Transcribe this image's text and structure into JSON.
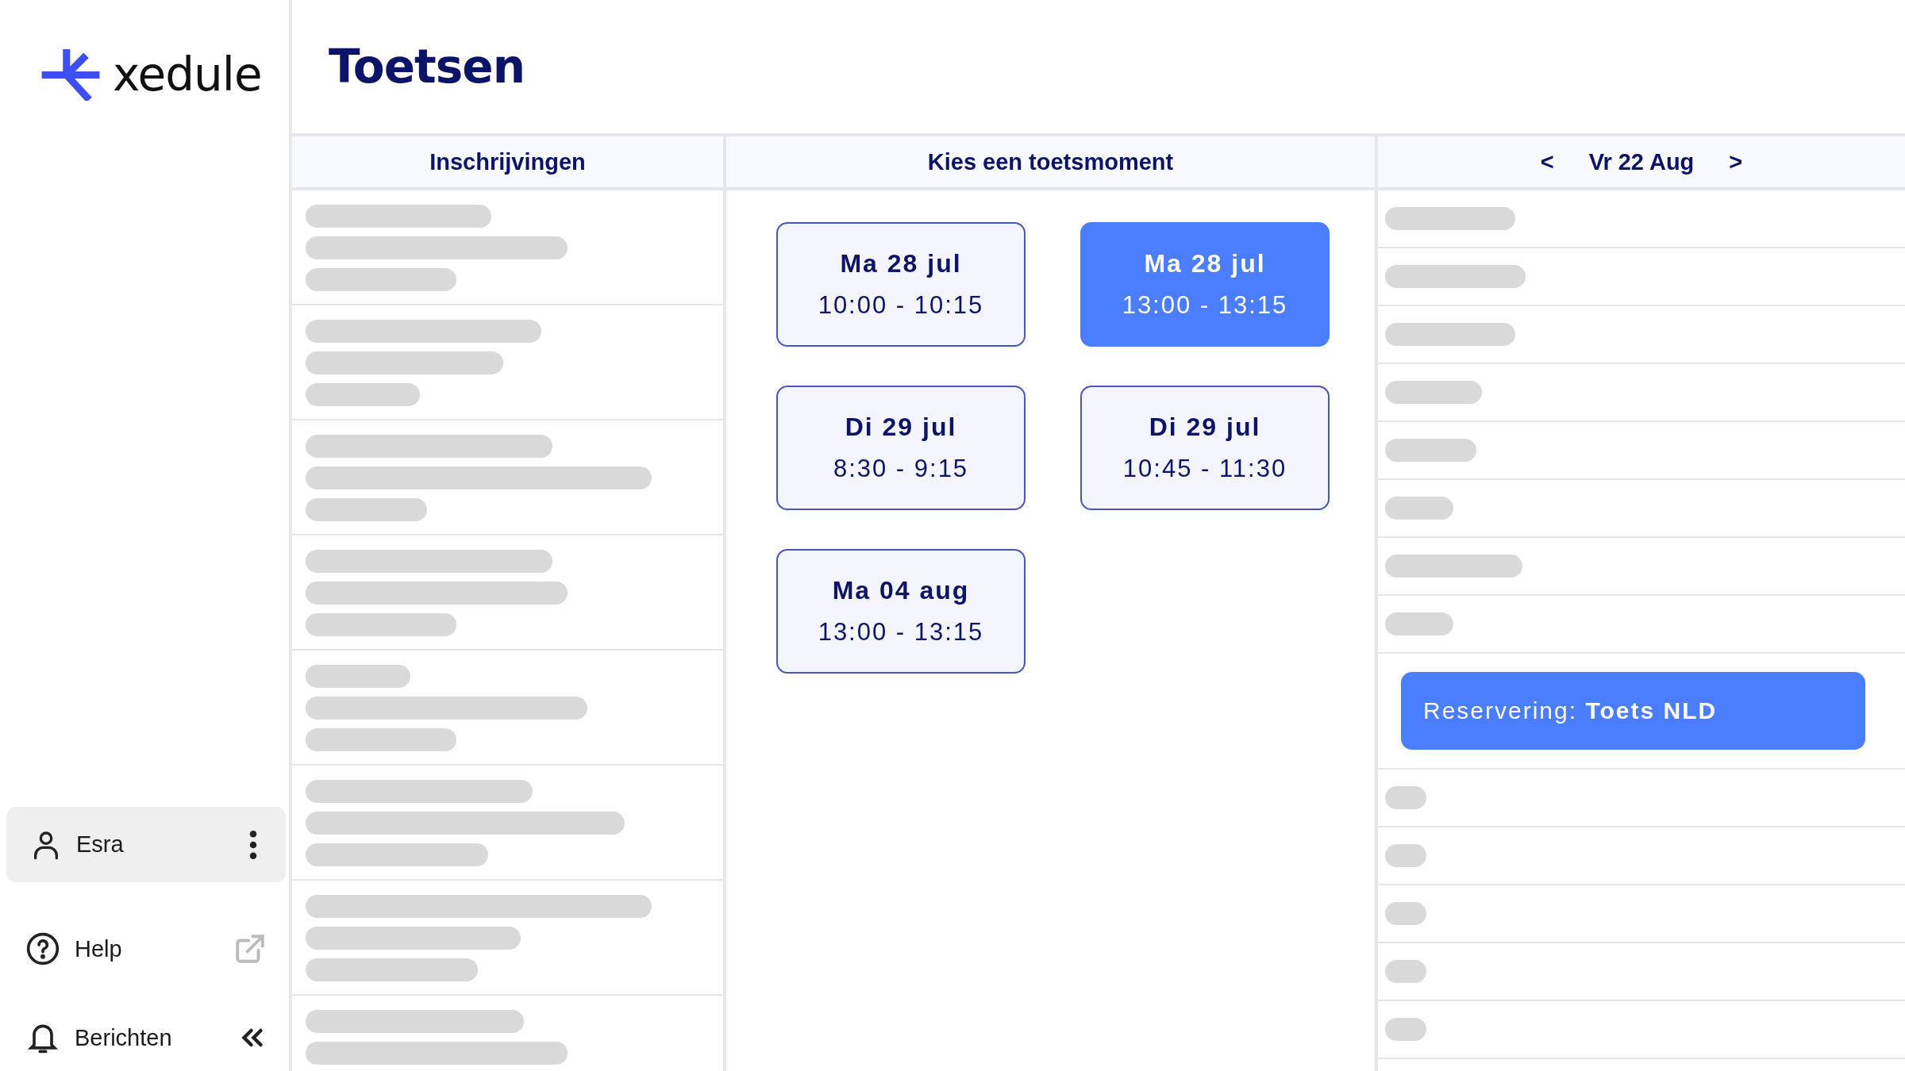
{
  "brand": {
    "name": "xedule"
  },
  "page": {
    "title": "Toetsen"
  },
  "columns": [
    {
      "heading": "Inschrijvingen"
    },
    {
      "heading": "Kies een toetsmoment"
    },
    {
      "heading": "Vr 22 Aug",
      "prev": "<",
      "next": ">"
    }
  ],
  "slots": [
    {
      "date": "Ma 28 jul",
      "time": "10:00 - 10:15",
      "selected": false
    },
    {
      "date": "Ma 28 jul",
      "time": "13:00 - 13:15",
      "selected": true
    },
    {
      "date": "Di 29 jul",
      "time": "8:30 - 9:15",
      "selected": false
    },
    {
      "date": "Di 29 jul",
      "time": "10:45 - 11:30",
      "selected": false
    },
    {
      "date": "Ma 04 aug",
      "time": "13:00 - 13:15",
      "selected": false
    }
  ],
  "reservation": {
    "text": "Reservering: **Toets NLD**"
  },
  "sidebar": {
    "user": {
      "name": "Esra"
    },
    "items": [
      {
        "label": "Help",
        "kind": "external"
      },
      {
        "label": "Berichten",
        "kind": "notifications"
      }
    ]
  }
}
